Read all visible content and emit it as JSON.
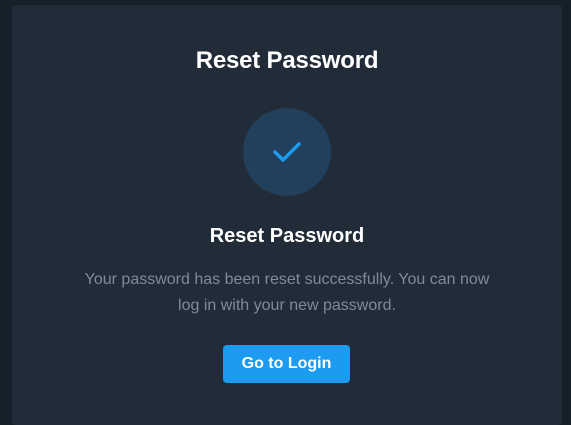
{
  "card": {
    "title": "Reset Password",
    "icon": "checkmark-icon",
    "subtitle": "Reset Password",
    "message_line1": "Your password has been reset successfully. You can now",
    "message_line2": "log in with your new password.",
    "button_label": "Go to Login"
  },
  "colors": {
    "page_background": "#16202a",
    "card_background": "#222c38",
    "accent": "#1d9bf0",
    "icon_circle": "#223f5c",
    "muted_text": "#7d8b99"
  }
}
